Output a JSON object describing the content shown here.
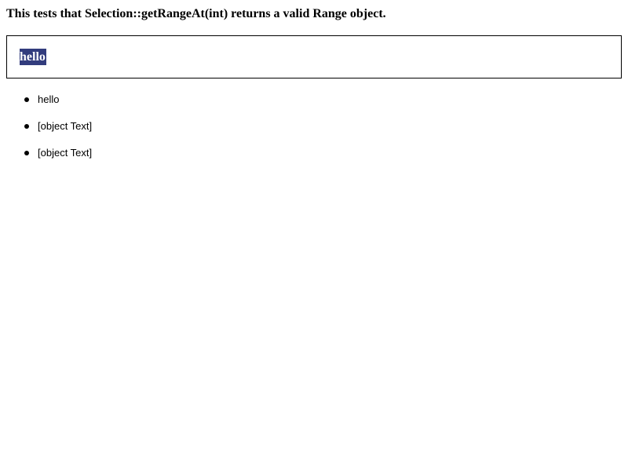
{
  "page": {
    "heading": "This tests that Selection::getRangeAt(int) returns a valid Range object."
  },
  "editor": {
    "selected_text": "hello",
    "selection_color": "#323c7d"
  },
  "results": [
    {
      "text": "hello"
    },
    {
      "text": "[object Text]"
    },
    {
      "text": "[object Text]"
    }
  ]
}
